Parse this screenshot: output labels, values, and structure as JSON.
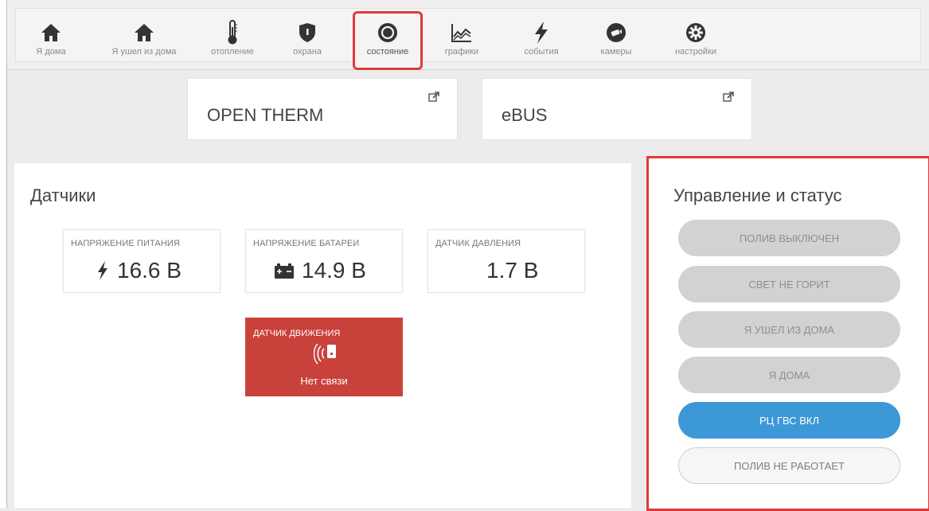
{
  "nav": {
    "items": [
      {
        "label": "Я дома",
        "icon": "home-icon"
      },
      {
        "label": "Я ушел из дома",
        "icon": "home-away-icon"
      },
      {
        "label": "отопление",
        "icon": "thermometer-icon"
      },
      {
        "label": "охрана",
        "icon": "shield-icon"
      },
      {
        "label": "состояние",
        "icon": "status-circle-icon",
        "active": true
      },
      {
        "label": "графики",
        "icon": "chart-icon"
      },
      {
        "label": "события",
        "icon": "lightning-icon"
      },
      {
        "label": "камеры",
        "icon": "camera-icon"
      },
      {
        "label": "настройки",
        "icon": "gear-icon"
      }
    ]
  },
  "links": {
    "opentherm": "OPEN THERM",
    "ebus": "eBUS"
  },
  "sensors": {
    "title": "Датчики",
    "supply": {
      "label": "НАПРЯЖЕНИЕ ПИТАНИЯ",
      "value": "16.6 В"
    },
    "battery": {
      "label": "НАПРЯЖЕНИЕ БАТАРЕИ",
      "value": "14.9 В"
    },
    "pressure": {
      "label": "ДАТЧИК ДАВЛЕНИЯ",
      "value": "1.7 В"
    },
    "motion": {
      "label": "ДАТЧИК ДВИЖЕНИЯ",
      "status": "Нет связи"
    }
  },
  "control": {
    "title": "Управление и статус",
    "buttons": [
      {
        "label": "ПОЛИВ ВЫКЛЮЧЕН"
      },
      {
        "label": "СВЕТ НЕ ГОРИТ"
      },
      {
        "label": "Я УШЕЛ ИЗ ДОМА"
      },
      {
        "label": "Я ДОМА"
      },
      {
        "label": "РЦ ГВС ВКЛ"
      },
      {
        "label": "ПОЛИВ НЕ РАБОТАЕТ"
      }
    ]
  },
  "colors": {
    "accent_red": "#e03a3a",
    "alarm_red": "#c9413b",
    "blue": "#3d98d8"
  }
}
